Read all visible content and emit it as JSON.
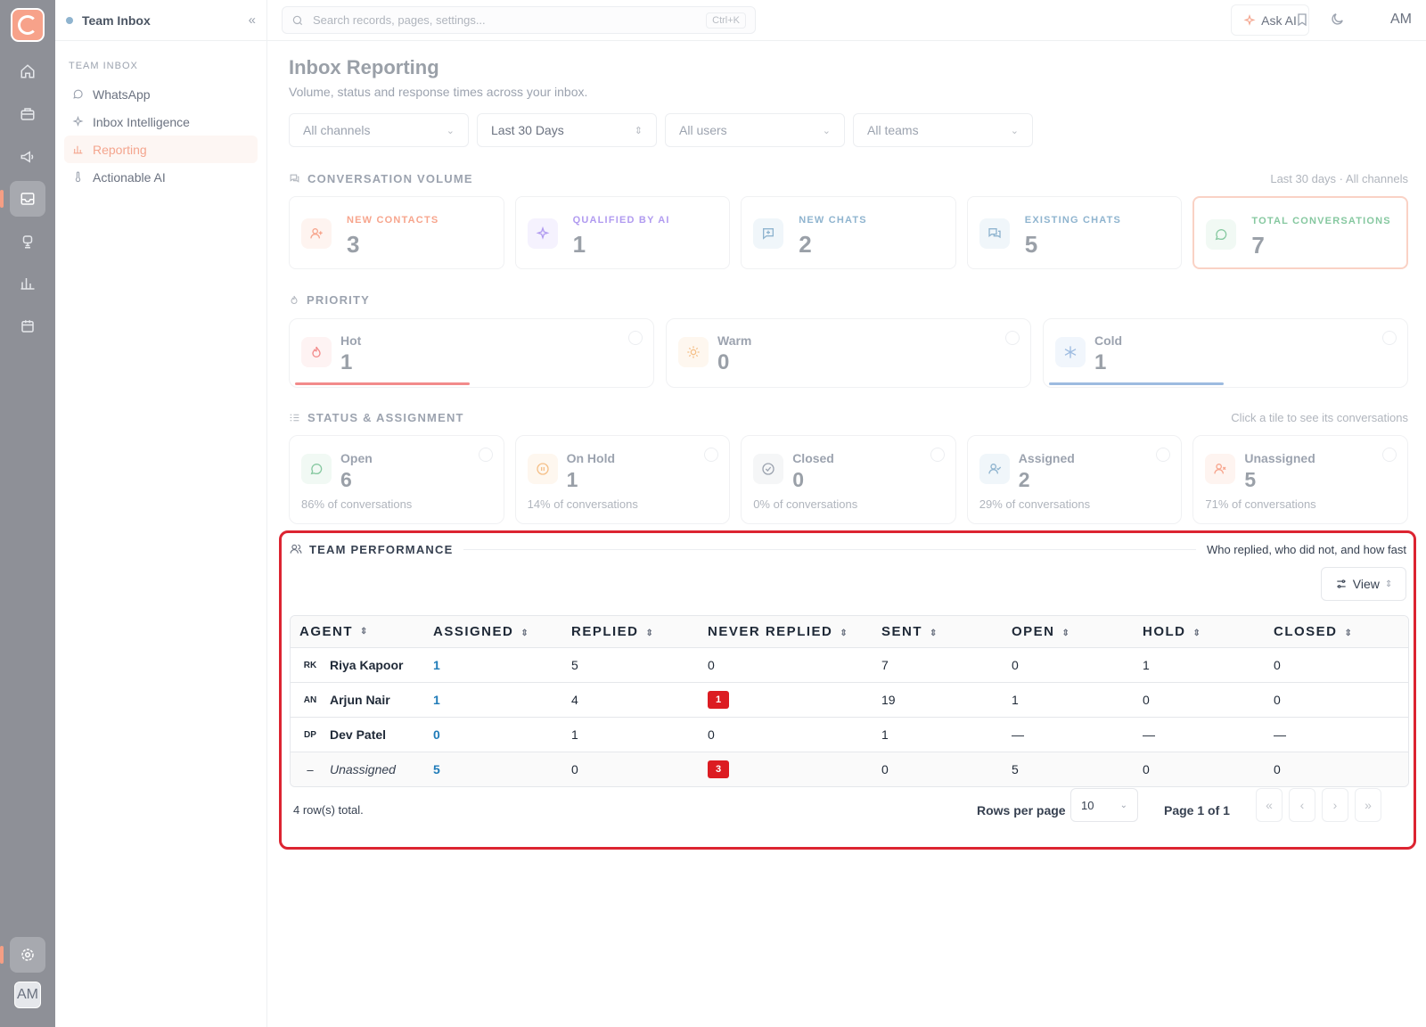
{
  "sidebar": {
    "title": "Team Inbox",
    "section": "TEAM INBOX",
    "items": [
      {
        "label": "WhatsApp",
        "icon": "whatsapp-icon"
      },
      {
        "label": "Inbox Intelligence",
        "icon": "sparkle-icon"
      },
      {
        "label": "Reporting",
        "icon": "bar-chart-icon",
        "active": true
      },
      {
        "label": "Actionable AI",
        "icon": "thermometer-icon"
      }
    ]
  },
  "rail": {
    "avatar": "AM"
  },
  "topbar": {
    "search_placeholder": "Search records, pages, settings...",
    "shortcut": "Ctrl+K",
    "ask_ai": "Ask AI",
    "user_initials": "AM"
  },
  "page": {
    "title": "Inbox Reporting",
    "subtitle": "Volume, status and response times across your inbox."
  },
  "filters": [
    "All channels",
    "Last 30 Days",
    "All users",
    "All teams"
  ],
  "volume": {
    "label": "CONVERSATION VOLUME",
    "note": "Last 30 days · All channels",
    "cards": [
      {
        "label": "NEW CONTACTS",
        "value": "3",
        "color": "#f7a58d"
      },
      {
        "label": "QUALIFIED BY AI",
        "value": "1",
        "color": "#b19bf0"
      },
      {
        "label": "NEW CHATS",
        "value": "2",
        "color": "#8fb4cf"
      },
      {
        "label": "EXISTING CHATS",
        "value": "5",
        "color": "#8fb4cf"
      },
      {
        "label": "TOTAL CONVERSATIONS",
        "value": "7",
        "color": "#86c8a0"
      }
    ]
  },
  "priority": {
    "label": "PRIORITY",
    "cards": [
      {
        "label": "Hot",
        "value": "1",
        "fill": 0.48,
        "color": "#f28b8b"
      },
      {
        "label": "Warm",
        "value": "0",
        "fill": 0,
        "color": "#f5c089"
      },
      {
        "label": "Cold",
        "value": "1",
        "fill": 0.48,
        "color": "#9dbbe0"
      }
    ]
  },
  "status": {
    "label": "STATUS & ASSIGNMENT",
    "note": "Click a tile to see its conversations",
    "cards": [
      {
        "label": "Open",
        "value": "6",
        "pct": "86% of conversations"
      },
      {
        "label": "On Hold",
        "value": "1",
        "pct": "14% of conversations"
      },
      {
        "label": "Closed",
        "value": "0",
        "pct": "0% of conversations"
      },
      {
        "label": "Assigned",
        "value": "2",
        "pct": "29% of conversations"
      },
      {
        "label": "Unassigned",
        "value": "5",
        "pct": "71% of conversations"
      }
    ]
  },
  "performance": {
    "label": "TEAM PERFORMANCE",
    "note": "Who replied, who did not, and how fast",
    "view_label": "View",
    "columns": [
      "AGENT",
      "ASSIGNED",
      "REPLIED",
      "NEVER REPLIED",
      "SENT",
      "OPEN",
      "HOLD",
      "CLOSED"
    ],
    "rows": [
      {
        "initials": "RK",
        "agent": "Riya Kapoor",
        "assigned": "1",
        "replied": "5",
        "never": "0",
        "never_badge": false,
        "sent": "7",
        "open": "0",
        "hold": "1",
        "closed": "0"
      },
      {
        "initials": "AN",
        "agent": "Arjun Nair",
        "assigned": "1",
        "replied": "4",
        "never": "1",
        "never_badge": true,
        "sent": "19",
        "open": "1",
        "hold": "0",
        "closed": "0"
      },
      {
        "initials": "DP",
        "agent": "Dev Patel",
        "assigned": "0",
        "replied": "1",
        "never": "0",
        "never_badge": false,
        "sent": "1",
        "open": "—",
        "hold": "—",
        "closed": "—"
      },
      {
        "initials": "–",
        "agent": "Unassigned",
        "assigned": "5",
        "replied": "0",
        "never": "3",
        "never_badge": true,
        "sent": "0",
        "open": "5",
        "hold": "0",
        "closed": "0"
      }
    ],
    "row_count": "4 row(s) total.",
    "rows_per_page_label": "Rows per page",
    "rows_per_page": "10",
    "page_label": "Page 1 of 1"
  }
}
